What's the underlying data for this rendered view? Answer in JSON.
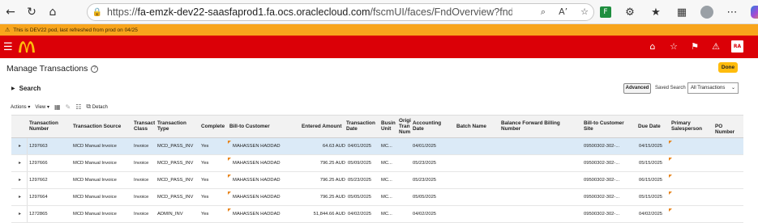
{
  "browser": {
    "url_prefix": "https://",
    "url_host": "fa-emzk-dev22-saasfaprod1.fa.ocs.oraclecloud.com",
    "url_path": "/fscmUI/faces/FndOverview?fndGlobalItemNodel..."
  },
  "banner": {
    "text": "This is DEV22 pod, last refreshed from prod on 04/25"
  },
  "app": {
    "user_initials": "RA",
    "brand_color": "#db0007",
    "accent_color": "#ffbc0d"
  },
  "page": {
    "title": "Manage Transactions",
    "done_label": "Done",
    "search_label": "Search",
    "advanced_label": "Advanced",
    "saved_search_label": "Saved Search",
    "saved_search_value": "All Transactions"
  },
  "toolbar": {
    "actions_label": "Actions",
    "view_label": "View",
    "detach_label": "Detach"
  },
  "table": {
    "columns": [
      "Transaction Number",
      "Transaction Source",
      "Transact Class",
      "Transaction Type",
      "Complete",
      "Bill-to Customer",
      "Entered Amount",
      "Transaction Date",
      "Busin Unit",
      "Origi Tran Num",
      "Accounting Date",
      "Batch Name",
      "Balance Forward Billing Number",
      "Bill-to Customer Site",
      "Due Date",
      "Primary Salesperson",
      "PO Number"
    ],
    "rows": [
      {
        "num": "1297663",
        "source": "MCD Manual Invoice",
        "cls": "Invoice",
        "type": "MCD_PASS_INV",
        "complete": "Yes",
        "customer": "MAHASSEN HADDAD",
        "amount": "64.63 AUD",
        "tdate": "04/01/2025",
        "bu": "MC...",
        "adate": "04/01/2025",
        "site": "09500302-302-...",
        "due": "04/15/2025"
      },
      {
        "num": "1297666",
        "source": "MCD Manual Invoice",
        "cls": "Invoice",
        "type": "MCD_PASS_INV",
        "complete": "Yes",
        "customer": "MAHASSEN HADDAD",
        "amount": "796.25 AUD",
        "tdate": "05/09/2025",
        "bu": "MC...",
        "adate": "05/23/2025",
        "site": "09500302-302-...",
        "due": "05/15/2025"
      },
      {
        "num": "1297662",
        "source": "MCD Manual Invoice",
        "cls": "Invoice",
        "type": "MCD_PASS_INV",
        "complete": "Yes",
        "customer": "MAHASSEN HADDAD",
        "amount": "796.25 AUD",
        "tdate": "05/23/2025",
        "bu": "MC...",
        "adate": "05/23/2025",
        "site": "09500302-302-...",
        "due": "06/15/2025"
      },
      {
        "num": "1297664",
        "source": "MCD Manual Invoice",
        "cls": "Invoice",
        "type": "MCD_PASS_INV",
        "complete": "Yes",
        "customer": "MAHASSEN HADDAD",
        "amount": "796.25 AUD",
        "tdate": "05/05/2025",
        "bu": "MC...",
        "adate": "05/05/2025",
        "site": "09500302-302-...",
        "due": "05/15/2025"
      },
      {
        "num": "1272865",
        "source": "MCD Manual Invoice",
        "cls": "Invoice",
        "type": "ADMIN_INV",
        "complete": "Yes",
        "customer": "MAHASSEN HADDAD",
        "amount": "51,844.66 AUD",
        "tdate": "04/02/2025",
        "bu": "MC...",
        "adate": "04/02/2025",
        "site": "09500302-302-...",
        "due": "04/02/2025"
      }
    ]
  }
}
